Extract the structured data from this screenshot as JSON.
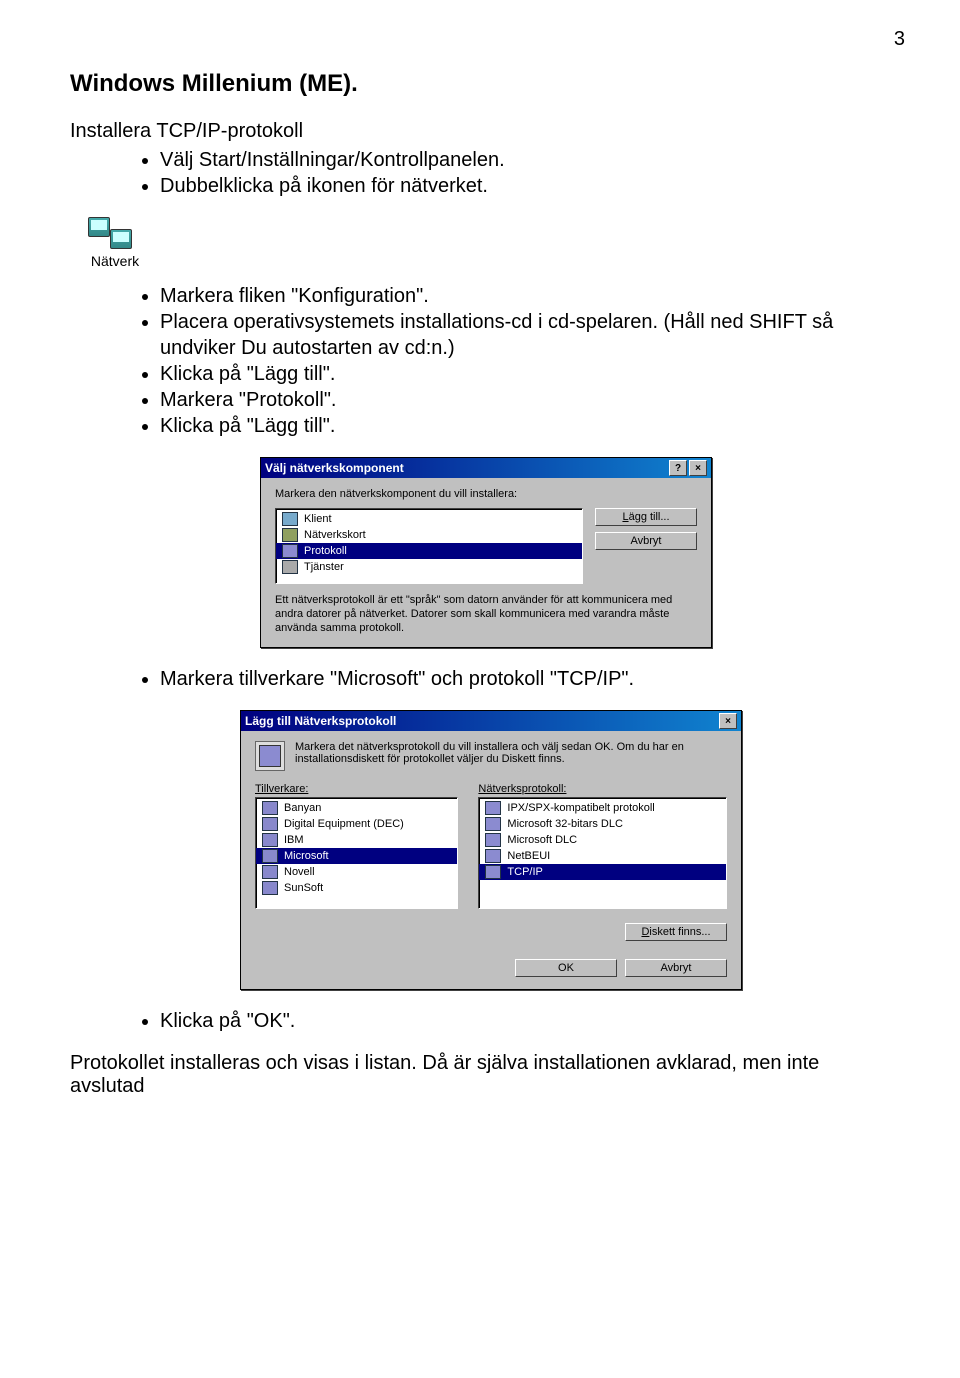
{
  "page_number": "3",
  "heading": "Windows Millenium (ME).",
  "subheading": "Installera TCP/IP-protokoll",
  "bullets_a": [
    "Välj Start/Inställningar/Kontrollpanelen.",
    "Dubbelklicka på ikonen för nätverket."
  ],
  "network_icon_label": "Nätverk",
  "bullets_b": [
    "Markera fliken \"Konfiguration\".",
    "Placera operativsystemets installations-cd i cd-spelaren. (Håll ned SHIFT så undviker Du autostarten av cd:n.)",
    "Klicka på \"Lägg till\".",
    "Markera \"Protokoll\".",
    "Klicka på \"Lägg till\"."
  ],
  "dialog1": {
    "title": "Välj nätverkskomponent",
    "prompt": "Markera den nätverkskomponent du vill installera:",
    "items": [
      {
        "label": "Klient",
        "icon": "client"
      },
      {
        "label": "Nätverkskort",
        "icon": "card"
      },
      {
        "label": "Protokoll",
        "icon": "proto",
        "selected": true
      },
      {
        "label": "Tjänster",
        "icon": "service"
      }
    ],
    "btn_add": "Lägg till...",
    "btn_cancel": "Avbryt",
    "description": "Ett nätverksprotokoll är ett \"språk\" som datorn använder för att kommunicera med andra datorer på nätverket. Datorer som skall kommunicera med varandra måste använda samma protokoll."
  },
  "bullets_c": [
    "Markera tillverkare \"Microsoft\" och protokoll \"TCP/IP\"."
  ],
  "dialog2": {
    "title": "Lägg till Nätverksprotokoll",
    "prompt": "Markera det nätverksprotokoll du vill installera och välj sedan OK. Om du har en installationsdiskett för protokollet väljer du Diskett finns.",
    "label_vendors": "Tillverkare:",
    "label_protocols": "Nätverksprotokoll:",
    "vendors": [
      {
        "label": "Banyan"
      },
      {
        "label": "Digital Equipment (DEC)"
      },
      {
        "label": "IBM"
      },
      {
        "label": "Microsoft",
        "selected": true
      },
      {
        "label": "Novell"
      },
      {
        "label": "SunSoft"
      }
    ],
    "protocols": [
      {
        "label": "IPX/SPX-kompatibelt protokoll"
      },
      {
        "label": "Microsoft 32-bitars DLC"
      },
      {
        "label": "Microsoft DLC"
      },
      {
        "label": "NetBEUI"
      },
      {
        "label": "TCP/IP",
        "selected": true
      }
    ],
    "btn_disk": "Diskett finns...",
    "btn_ok": "OK",
    "btn_cancel": "Avbryt"
  },
  "bullets_d": [
    "Klicka på \"OK\"."
  ],
  "footer_text": "Protokollet installeras och visas i listan. Då är själva installationen avklarad, men inte avslutad"
}
